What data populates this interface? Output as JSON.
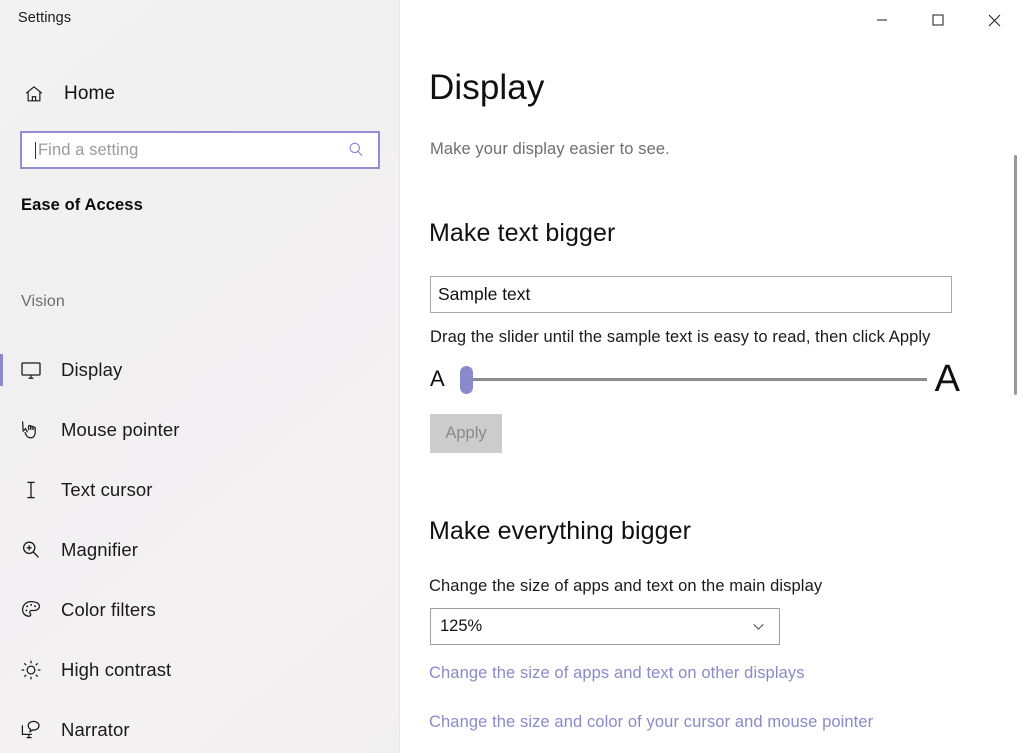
{
  "window": {
    "title": "Settings",
    "controls": {
      "minimize": "minimize-icon",
      "maximize": "maximize-icon",
      "close": "close-icon"
    }
  },
  "colors": {
    "accent": "#8a8acb",
    "sidebar_bg": "#f2f1f1",
    "main_bg": "#ffffff",
    "disabled_button_bg": "#cccccc",
    "disabled_button_text": "#8a8a8a"
  },
  "sidebar": {
    "home": {
      "label": "Home",
      "icon": "home-icon"
    },
    "search": {
      "value": "",
      "placeholder": "Find a setting",
      "icon": "search-icon"
    },
    "category": "Ease of Access",
    "group_heading": "Vision",
    "items": [
      {
        "label": "Display",
        "icon": "monitor-icon",
        "selected": true
      },
      {
        "label": "Mouse pointer",
        "icon": "mouse-pointer-icon",
        "selected": false
      },
      {
        "label": "Text cursor",
        "icon": "text-cursor-icon",
        "selected": false
      },
      {
        "label": "Magnifier",
        "icon": "magnifier-icon",
        "selected": false
      },
      {
        "label": "Color filters",
        "icon": "palette-icon",
        "selected": false
      },
      {
        "label": "High contrast",
        "icon": "brightness-icon",
        "selected": false
      },
      {
        "label": "Narrator",
        "icon": "narrator-icon",
        "selected": false
      }
    ]
  },
  "main": {
    "page_title": "Display",
    "page_subtitle": "Make your display easier to see.",
    "make_text_bigger": {
      "heading": "Make text bigger",
      "sample_value": "Sample text",
      "hint": "Drag the slider until the sample text is easy to read, then click Apply",
      "slider_min_label": "A",
      "slider_max_label": "A",
      "slider_value": 0,
      "slider_min": 0,
      "slider_max": 100,
      "apply_label": "Apply",
      "apply_enabled": false
    },
    "make_everything_bigger": {
      "heading": "Make everything bigger",
      "field_label": "Change the size of apps and text on the main display",
      "scale_value": "125%",
      "scale_chevron": "chevron-down-icon",
      "links": [
        "Change the size of apps and text on other displays",
        "Change the size and color of your cursor and mouse pointer"
      ]
    }
  }
}
